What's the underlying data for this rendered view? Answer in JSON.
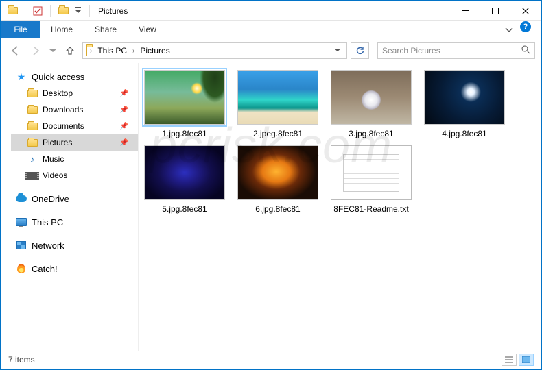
{
  "window": {
    "title": "Pictures"
  },
  "ribbon": {
    "file": "File",
    "tabs": [
      "Home",
      "Share",
      "View"
    ]
  },
  "breadcrumb": {
    "items": [
      "This PC",
      "Pictures"
    ]
  },
  "search": {
    "placeholder": "Search Pictures"
  },
  "sidebar": {
    "quick_access": {
      "label": "Quick access",
      "items": [
        {
          "label": "Desktop",
          "pinned": true
        },
        {
          "label": "Downloads",
          "pinned": true
        },
        {
          "label": "Documents",
          "pinned": true
        },
        {
          "label": "Pictures",
          "pinned": true,
          "selected": true
        },
        {
          "label": "Music",
          "pinned": false
        },
        {
          "label": "Videos",
          "pinned": false
        }
      ]
    },
    "roots": [
      {
        "label": "OneDrive"
      },
      {
        "label": "This PC"
      },
      {
        "label": "Network"
      },
      {
        "label": "Catch!"
      }
    ]
  },
  "files": [
    {
      "name": "1.jpg.8fec81",
      "type": "image",
      "art": "art1",
      "selected": true
    },
    {
      "name": "2.jpeg.8fec81",
      "type": "image",
      "art": "art2"
    },
    {
      "name": "3.jpg.8fec81",
      "type": "image",
      "art": "art3"
    },
    {
      "name": "4.jpg.8fec81",
      "type": "image",
      "art": "art4"
    },
    {
      "name": "5.jpg.8fec81",
      "type": "image",
      "art": "art5"
    },
    {
      "name": "6.jpg.8fec81",
      "type": "image",
      "art": "art6"
    },
    {
      "name": "8FEC81-Readme.txt",
      "type": "text"
    }
  ],
  "status": {
    "count_label": "7 items"
  },
  "watermark": "pcrisk.com"
}
